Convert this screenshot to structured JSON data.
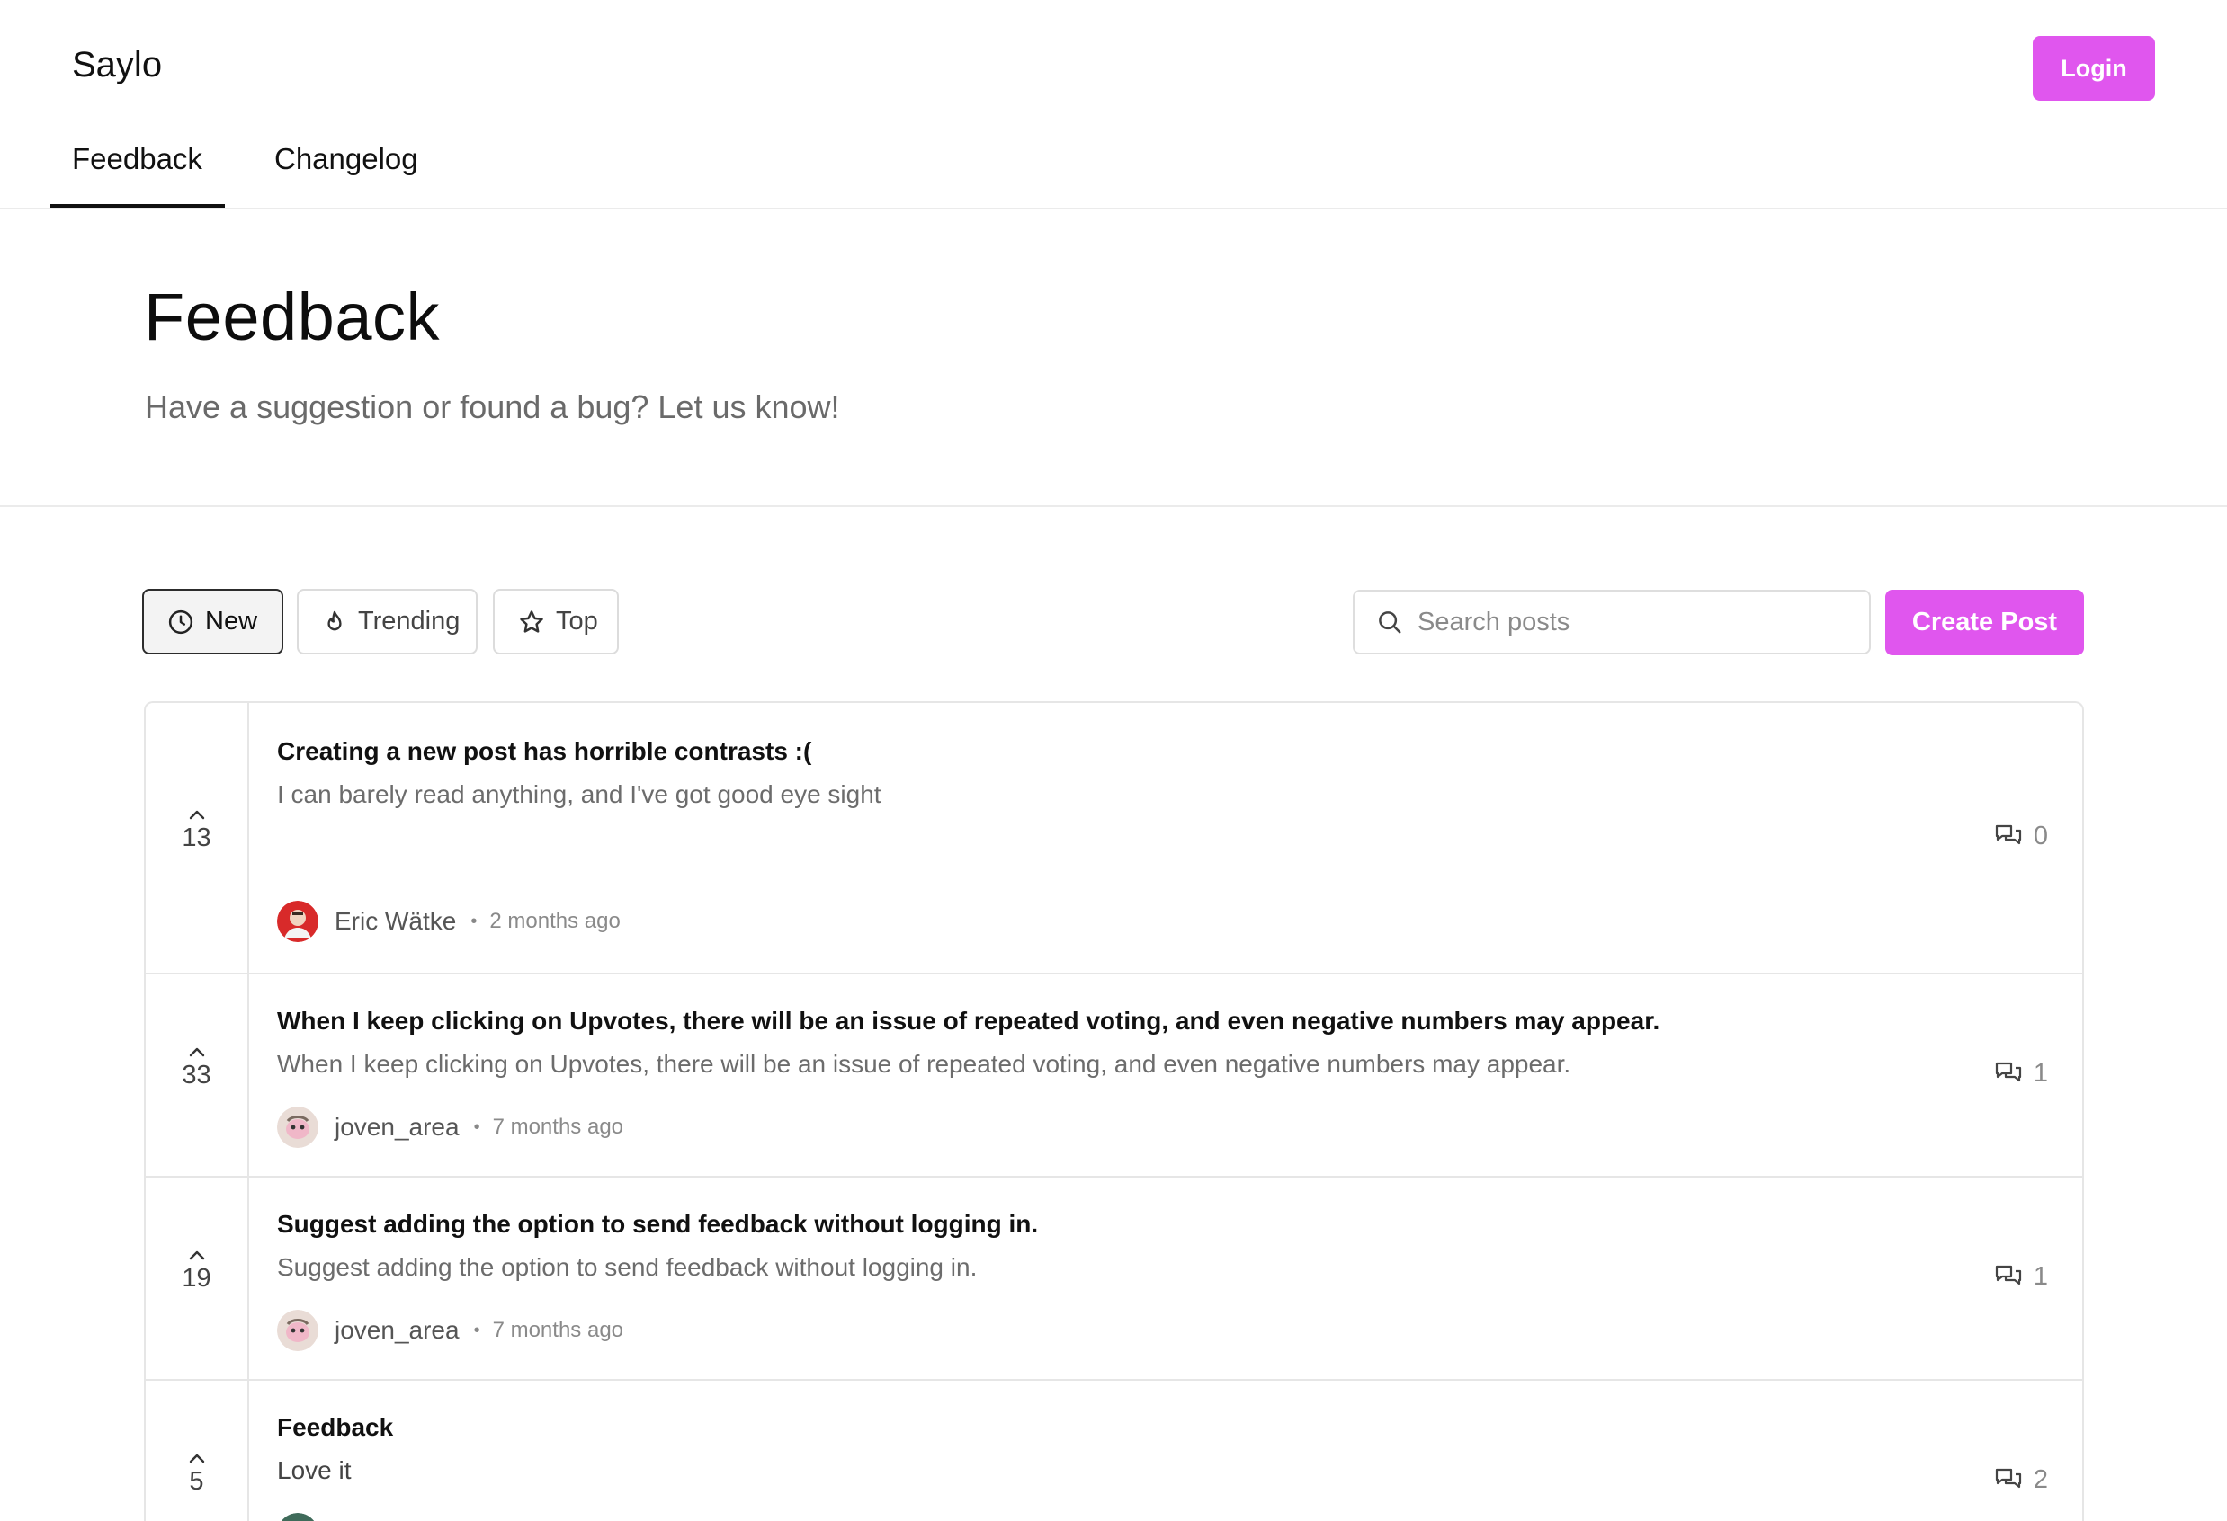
{
  "header": {
    "brand": "Saylo",
    "login_label": "Login",
    "tabs": [
      {
        "label": "Feedback",
        "active": true
      },
      {
        "label": "Changelog",
        "active": false
      }
    ]
  },
  "hero": {
    "title": "Feedback",
    "subtitle": "Have a suggestion or found a bug? Let us know!"
  },
  "toolbar": {
    "sort_options": [
      {
        "label": "New",
        "icon": "clock-icon",
        "active": true
      },
      {
        "label": "Trending",
        "icon": "flame-icon",
        "active": false
      },
      {
        "label": "Top",
        "icon": "star-icon",
        "active": false
      }
    ],
    "search_placeholder": "Search posts",
    "create_label": "Create Post"
  },
  "colors": {
    "accent": "#e056ee"
  },
  "posts": [
    {
      "votes": "13",
      "title": "Creating a new post has horrible contrasts :(",
      "body": "I can barely read anything, and I've got good eye sight",
      "author": "Eric Wätke",
      "time": "2 months ago",
      "comments": "0"
    },
    {
      "votes": "33",
      "title": "When I keep clicking on Upvotes, there will be an issue of repeated voting, and even negative numbers may appear.",
      "body": "When I keep clicking on Upvotes, there will be an issue of repeated voting, and even negative numbers may appear.",
      "author": "joven_area",
      "time": "7 months ago",
      "comments": "1"
    },
    {
      "votes": "19",
      "title": "Suggest adding the option to send feedback without logging in.",
      "body": "Suggest adding the option to send feedback without logging in.",
      "author": "joven_area",
      "time": "7 months ago",
      "comments": "1"
    },
    {
      "votes": "5",
      "title": "Feedback",
      "body": "Love it",
      "author": "",
      "time": "",
      "comments": "2"
    }
  ]
}
